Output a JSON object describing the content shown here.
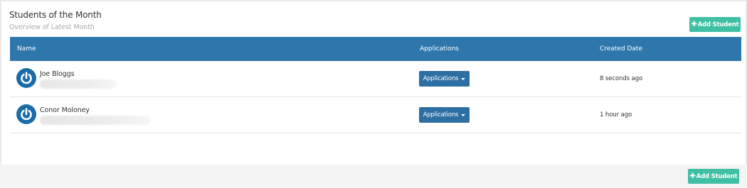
{
  "panel": {
    "title": "Students of the Month",
    "subtitle": "Overview of Latest Month",
    "add_button_label": "Add Student"
  },
  "table": {
    "columns": [
      "Name",
      "Applications",
      "Created Date"
    ],
    "rows": [
      {
        "name": "Joe Bloggs",
        "applications_label": "Applications",
        "created": "8 seconds ago"
      },
      {
        "name": "Conor Moloney",
        "applications_label": "Applications",
        "created": "1 hour ago"
      }
    ]
  },
  "footer": {
    "add_button_label": "Add Student"
  },
  "icons": {
    "avatar": "power-icon",
    "add": "plus-icon",
    "dropdown": "caret-down-icon"
  },
  "colors": {
    "header_bg": "#2e77ad",
    "add_button": "#3fc0a4",
    "applications_button": "#2d6ea3",
    "avatar": "#1b6ba8"
  }
}
